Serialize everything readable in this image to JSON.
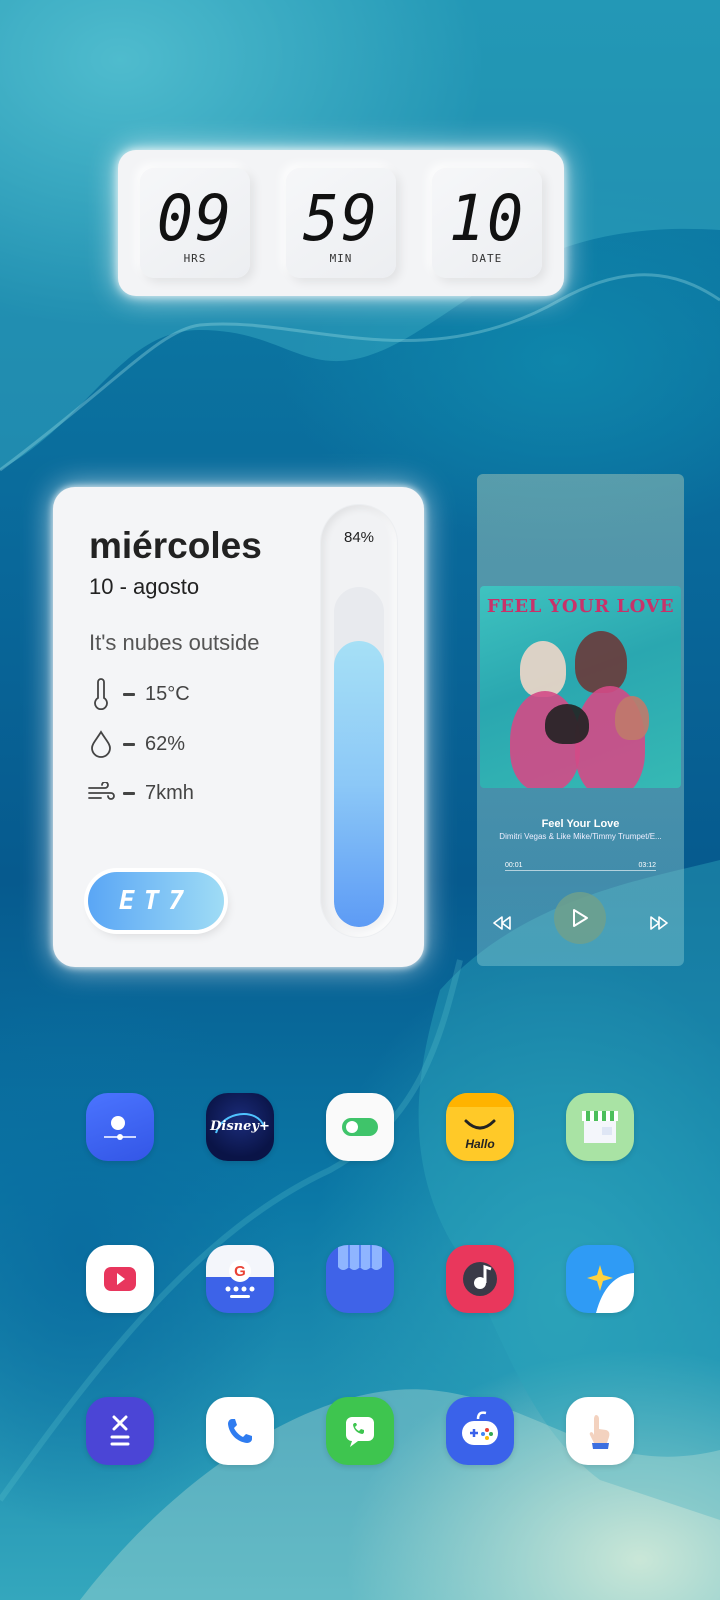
{
  "clock": {
    "hours": "09",
    "hours_label": "HRS",
    "minutes": "59",
    "minutes_label": "MIN",
    "date": "10",
    "date_label": "DATE"
  },
  "weather": {
    "day": "miércoles",
    "date": "10 - agosto",
    "condition": "It's nubes outside",
    "temperature": "15°C",
    "humidity": "62%",
    "wind": "7kmh",
    "button_label": "ET7",
    "level_percent_label": "84%",
    "level_fraction": 0.84
  },
  "music": {
    "album_title": "FEEL YOUR LOVE",
    "track_title": "Feel Your Love",
    "artist": "Dimitri Vegas & Like Mike/Timmy Trumpet/E...",
    "elapsed": "00:01",
    "duration": "03:12"
  },
  "apps": {
    "disney_text": "Disney+",
    "hallo_text": "Hallo"
  },
  "icons": {
    "row1": [
      "screen-recorder-icon",
      "disney-plus-icon",
      "toggle-settings-icon",
      "hallo-icon",
      "store-icon"
    ],
    "row2": [
      "video-player-icon",
      "google-keyboard-icon",
      "galaxy-store-icon",
      "music-player-icon",
      "weather-app-icon"
    ],
    "row3": [
      "calculator-icon",
      "phone-icon",
      "messages-phone-icon",
      "game-launcher-icon",
      "hand-tips-icon"
    ]
  }
}
